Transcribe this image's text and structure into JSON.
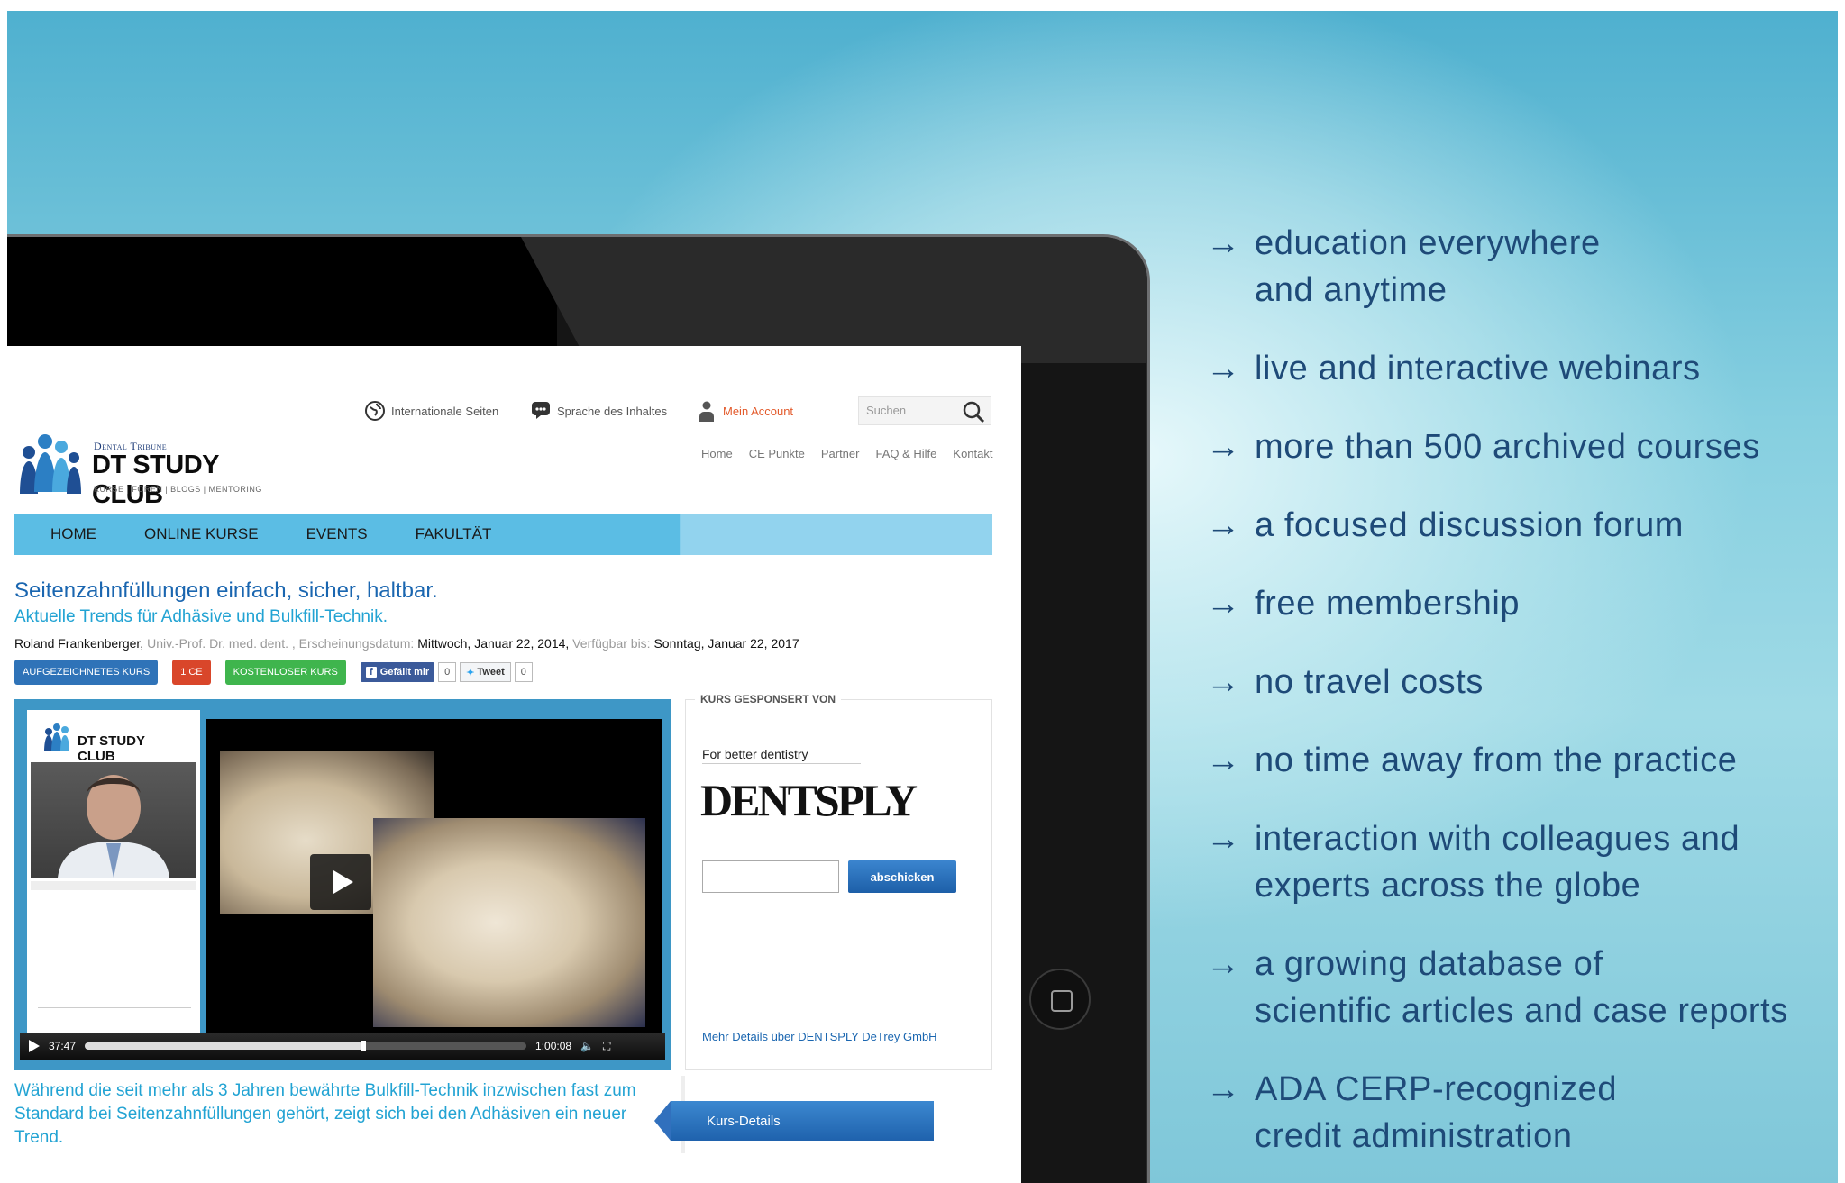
{
  "header": {
    "international_label": "Internationale Seiten",
    "language_label": "Sprache des Inhaltes",
    "account_label": "Mein Account",
    "search_placeholder": "Suchen",
    "top_links": [
      "Home",
      "CE Punkte",
      "Partner",
      "FAQ & Hilfe",
      "Kontakt"
    ]
  },
  "logo": {
    "brand_small": "Dental Tribune",
    "name": "DT STUDY CLUB",
    "subtitle": "KURSE | FOREN | BLOGS | MENTORING"
  },
  "nav": [
    "HOME",
    "ONLINE KURSE",
    "EVENTS",
    "FAKULTÄT"
  ],
  "article": {
    "title": "Seitenzahnfüllungen einfach, sicher, haltbar.",
    "subtitle": "Aktuelle Trends für Adhäsive und Bulkfill-Technik.",
    "author": "Roland Frankenberger,",
    "author_title": " Univ.-Prof. Dr. med. dent. , Erscheinungsdatum: ",
    "published": "Mittwoch, Januar 22, 2014,",
    "available_label": " Verfügbar bis: ",
    "available_until": "Sonntag, Januar 22, 2017",
    "tags": [
      "AUFGEZEICHNETES KURS",
      "1 CE",
      "KOSTENLOSER KURS"
    ],
    "like_label": "Gefällt mir",
    "like_count": "0",
    "tweet_label": "Tweet",
    "tweet_count": "0",
    "body": "Während die seit mehr als 3 Jahren bewährte Bulkfill-Technik inzwischen fast zum Standard bei Seitenzahnfüllungen gehört, zeigt sich bei den Adhäsiven ein neuer Trend.",
    "details_button": "Kurs-Details"
  },
  "player": {
    "logo_text": "DT STUDY CLUB",
    "elapsed": "37:47",
    "duration": "1:00:08",
    "progress": 0.63
  },
  "sponsor": {
    "heading": "KURS GESPONSERT VON",
    "tagline": "For better dentistry",
    "brand": "DENTSPLY",
    "submit_label": "abschicken",
    "link": "Mehr Details über DENTSPLY DeTrey GmbH"
  },
  "features": [
    [
      "education everywhere",
      "and anytime"
    ],
    [
      "live and interactive webinars"
    ],
    [
      "more than 500 archived courses"
    ],
    [
      "a focused discussion forum"
    ],
    [
      "free membership"
    ],
    [
      "no travel costs"
    ],
    [
      "no time away from the practice"
    ],
    [
      "interaction with colleagues and",
      "experts across the globe"
    ],
    [
      "a growing database of",
      "scientific articles and case reports"
    ],
    [
      "ADA CERP-recognized",
      "credit administration"
    ]
  ],
  "colors": {
    "accent_blue": "#1a66b0",
    "light_blue": "#22a3d3",
    "nav_blue": "#5bbde4",
    "feature_text": "#1e4a78"
  }
}
